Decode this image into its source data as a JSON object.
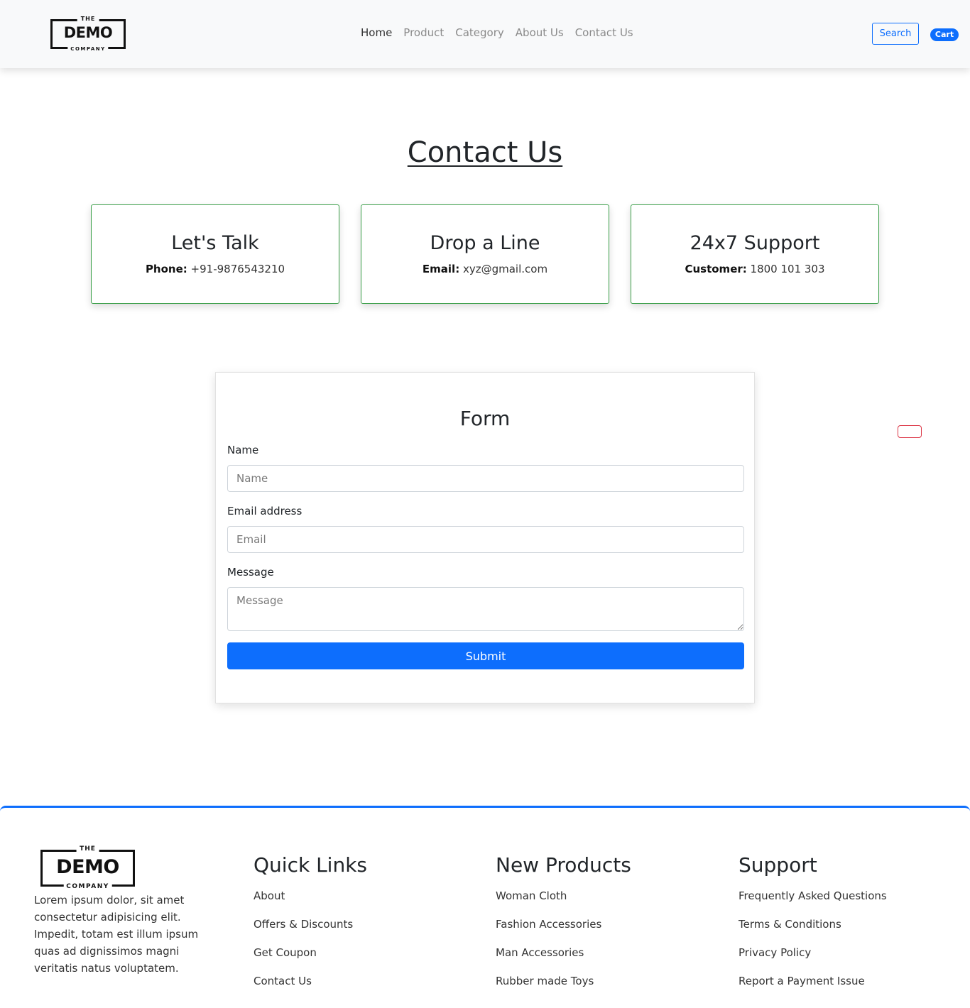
{
  "brand": {
    "the": "THE",
    "name": "DEMO",
    "company": "COMPANY"
  },
  "nav": {
    "links": [
      "Home",
      "Product",
      "Category",
      "About Us",
      "Contact Us"
    ],
    "search_label": "Search",
    "cart_label": "Cart"
  },
  "page": {
    "title": "Contact Us"
  },
  "cards": [
    {
      "title": "Let's Talk",
      "key": "Phone:",
      "value": "+91-9876543210"
    },
    {
      "title": "Drop a Line",
      "key": "Email:",
      "value": "xyz@gmail.com"
    },
    {
      "title": "24x7 Support",
      "key": "Customer:",
      "value": "1800 101 303"
    }
  ],
  "form": {
    "title": "Form",
    "name_label": "Name",
    "name_placeholder": "Name",
    "email_label": "Email address",
    "email_placeholder": "Email",
    "message_label": "Message",
    "message_placeholder": "Message",
    "submit_label": "Submit"
  },
  "footer": {
    "about": "Lorem ipsum dolor, sit amet consectetur adipisicing elit. Impedit, totam est illum ipsum quas ad dignissimos magni veritatis natus voluptatem.",
    "quick_links": {
      "title": "Quick Links",
      "items": [
        "About",
        "Offers & Discounts",
        "Get Coupon",
        "Contact Us"
      ]
    },
    "new_products": {
      "title": "New Products",
      "items": [
        "Woman Cloth",
        "Fashion Accessories",
        "Man Accessories",
        "Rubber made Toys"
      ]
    },
    "support": {
      "title": "Support",
      "items": [
        "Frequently Asked Questions",
        "Terms & Conditions",
        "Privacy Policy",
        "Report a Payment Issue"
      ]
    }
  },
  "colors": {
    "primary": "#0d6efd",
    "card_border": "#3ca04a",
    "danger": "#dc3545",
    "navbar_bg": "#f8f9fa"
  }
}
